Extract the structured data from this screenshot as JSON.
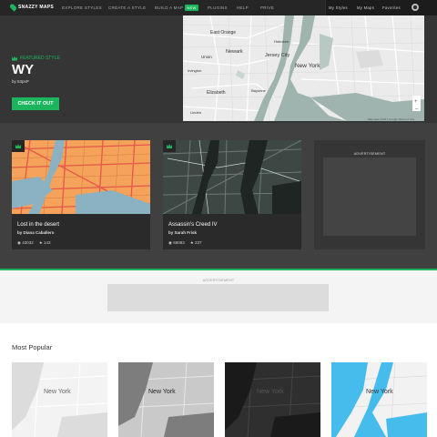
{
  "nav": {
    "logo": "SNAZZY MAPS",
    "items": [
      "EXPLORE STYLES",
      "CREATE A STYLE",
      "BUILD A MAP",
      "PLUGINS",
      "HELP",
      "PRIVE"
    ],
    "new_badge": "NEW",
    "right": [
      "My Styles",
      "My Maps",
      "Favorites"
    ]
  },
  "featured": {
    "tag": "FEATURED STYLE",
    "title": "WY",
    "by": "by 53psP",
    "cta": "CHECK IT OUT",
    "map_labels": [
      "East Orange",
      "Newark",
      "Union",
      "Elizabeth",
      "Jersey City",
      "New York",
      "Hoboken",
      "Bayonne",
      "Linden",
      "Irvington"
    ],
    "map_attrib": "Map data ©2017 Google  Terms of Use"
  },
  "cards": [
    {
      "title": "Lost in the desert",
      "by": "by Diana Caballero",
      "views": "43032",
      "favs": "143"
    },
    {
      "title": "Assassin's Creed IV",
      "by": "by Sarah Frisk",
      "views": "68083",
      "favs": "237"
    }
  ],
  "ads": {
    "label": "ADVERTISEMENT"
  },
  "popular": {
    "title": "Most Popular",
    "map_label": "New York"
  },
  "colors": {
    "accent": "#1ab55c",
    "nav_bg": "#262626",
    "hero_bg": "#353535"
  }
}
